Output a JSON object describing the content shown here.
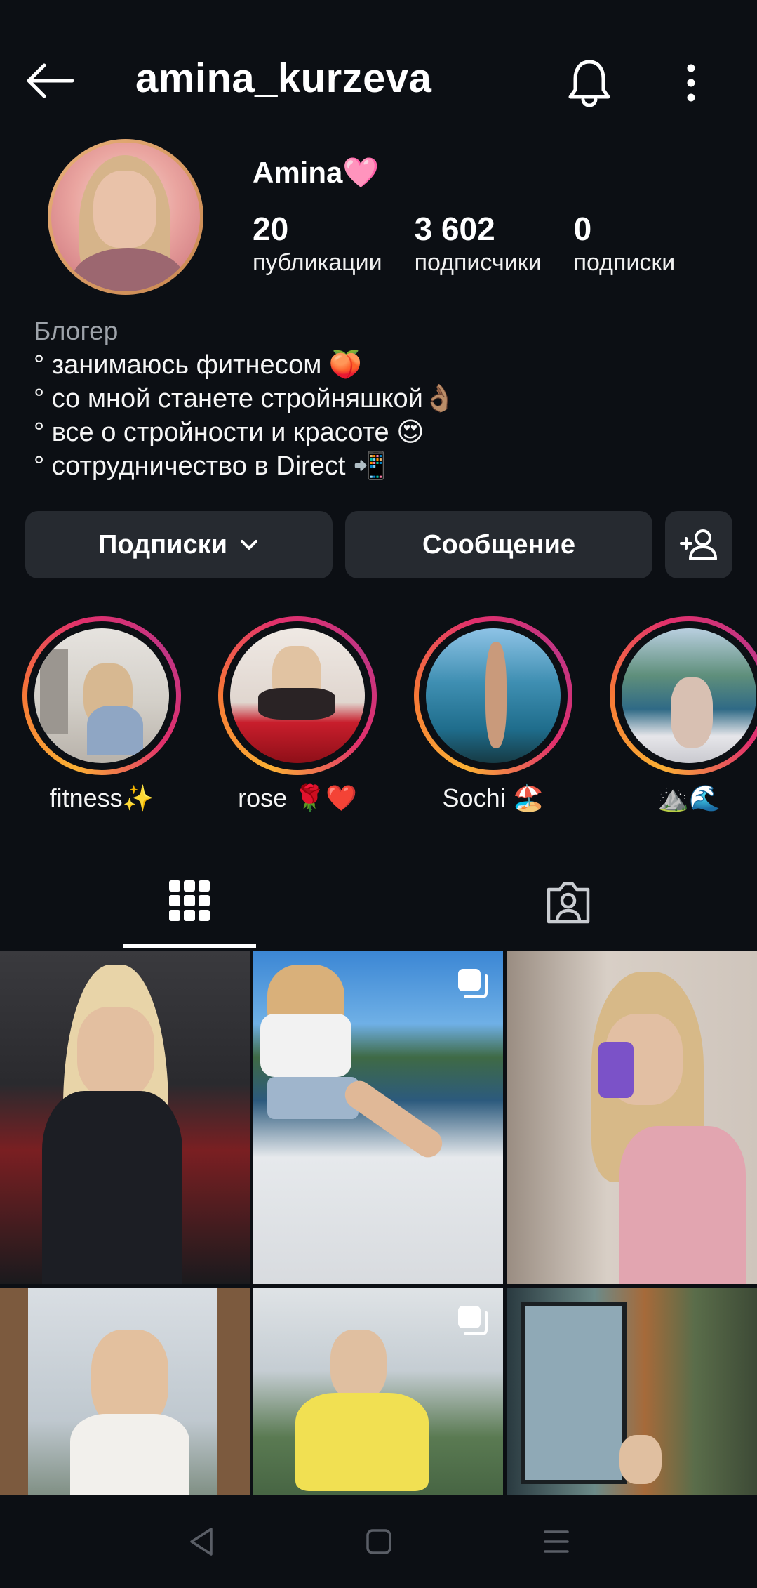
{
  "header": {
    "username": "amina_kurzeva"
  },
  "profile": {
    "display_name": "Amina🩷",
    "stats": [
      {
        "value": "20",
        "label": "публикации"
      },
      {
        "value": "3 602",
        "label": "подписчики"
      },
      {
        "value": "0",
        "label": "подписки"
      }
    ],
    "bio": {
      "category": "Блогер",
      "lines": [
        "° занимаюсь фитнесом 🍑",
        "° со мной станете стройняшкой👌🏽",
        "° все о стройности и красоте 😍",
        "° сотрудничество в Direct 📲"
      ]
    }
  },
  "actions": {
    "following_label": "Подписки",
    "message_label": "Сообщение"
  },
  "highlights": [
    {
      "label": "fitness✨"
    },
    {
      "label": "rose 🌹❤️"
    },
    {
      "label": "Sochi 🏖️"
    },
    {
      "label": "⛰️🌊"
    }
  ],
  "tabs": [
    {
      "name": "grid",
      "icon": "grid-icon",
      "active": true
    },
    {
      "name": "tagged",
      "icon": "tagged-person-icon",
      "active": false
    }
  ],
  "posts": [
    {
      "multi": false
    },
    {
      "multi": true
    },
    {
      "multi": false
    },
    {
      "multi": false
    },
    {
      "multi": true
    },
    {
      "multi": false
    }
  ],
  "colors": {
    "background": "#0c0f14",
    "button": "#262a30",
    "story_ring_start": "#fbb034",
    "story_ring_end": "#c13584"
  }
}
